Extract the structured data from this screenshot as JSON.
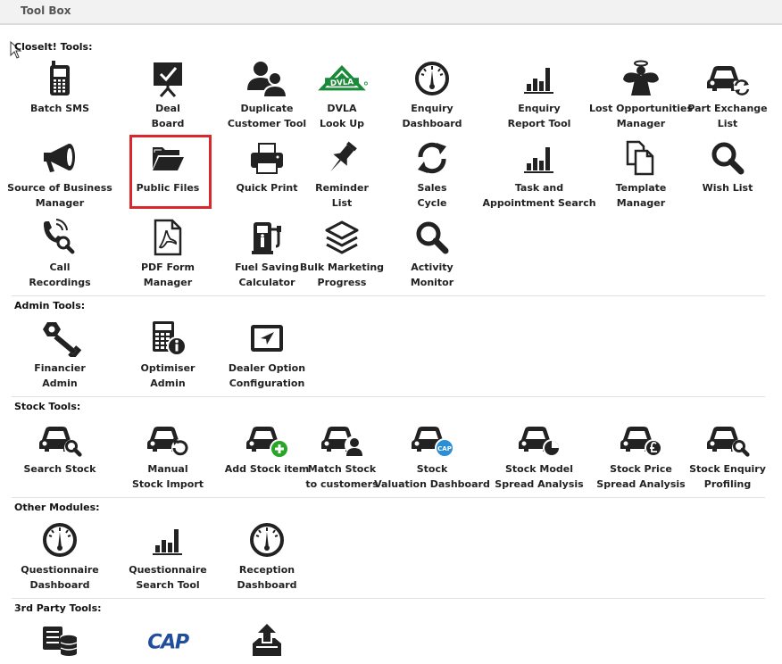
{
  "header": {
    "title": "Tool Box"
  },
  "sections": [
    {
      "title": "CloseIt! Tools:",
      "tools": [
        {
          "label": "Batch SMS",
          "icon": "mobile-phone-icon"
        },
        {
          "label": "Deal\nBoard",
          "icon": "presentation-board-icon"
        },
        {
          "label": "Duplicate\nCustomer Tool",
          "icon": "users-icon"
        },
        {
          "label": "DVLA\nLook Up",
          "icon": "dvla-logo",
          "logo_text": "DVLA"
        },
        {
          "label": "Enquiry\nDashboard",
          "icon": "gauge-icon"
        },
        {
          "label": "Enquiry\nReport Tool",
          "icon": "bar-chart-icon"
        },
        {
          "label": "Lost Opportunities\nManager",
          "icon": "angel-icon"
        },
        {
          "label": "Part Exchange\nList",
          "icon": "car-sync-icon"
        },
        {
          "label": "Source of Business\nManager",
          "icon": "megaphone-icon"
        },
        {
          "label": "Public Files",
          "icon": "folder-open-icon"
        },
        {
          "label": "Quick Print",
          "icon": "printer-icon"
        },
        {
          "label": "Reminder\nList",
          "icon": "pushpin-icon"
        },
        {
          "label": "Sales\nCycle",
          "icon": "refresh-icon"
        },
        {
          "label": "Task and\nAppointment Search",
          "icon": "bar-chart-icon"
        },
        {
          "label": "Template\nManager",
          "icon": "documents-icon"
        },
        {
          "label": "Wish List",
          "icon": "search-icon"
        },
        {
          "label": "Call\nRecordings",
          "icon": "phone-search-icon"
        },
        {
          "label": "PDF Form\nManager",
          "icon": "pdf-file-icon"
        },
        {
          "label": "Fuel Saving\nCalculator",
          "icon": "fuel-pump-icon"
        },
        {
          "label": "Bulk Marketing\nProgress",
          "icon": "layers-icon"
        },
        {
          "label": "Activity\nMonitor",
          "icon": "search-icon"
        }
      ]
    },
    {
      "title": "Admin Tools:",
      "tools": [
        {
          "label": "Financier\nAdmin",
          "icon": "nut-wrench-icon"
        },
        {
          "label": "Optimiser\nAdmin",
          "icon": "calculator-info-icon"
        },
        {
          "label": "Dealer Option\nConfiguration",
          "icon": "screen-navigation-icon"
        }
      ]
    },
    {
      "title": "Stock Tools:",
      "tools": [
        {
          "label": "Search Stock",
          "icon": "car-search-icon"
        },
        {
          "label": "Manual\nStock Import",
          "icon": "car-refresh-icon"
        },
        {
          "label": "Add Stock item",
          "icon": "car-add-icon"
        },
        {
          "label": "Match Stock\nto customers",
          "icon": "car-user-icon"
        },
        {
          "label": "Stock\nValuation Dashboard",
          "icon": "car-cap-icon",
          "badge_text": "CAP"
        },
        {
          "label": "Stock Model\nSpread Analysis",
          "icon": "car-pie-chart-icon"
        },
        {
          "label": "Stock Price\nSpread Analysis",
          "icon": "car-pound-icon"
        },
        {
          "label": "Stock Enquiry\nProfiling",
          "icon": "car-search-icon"
        }
      ]
    },
    {
      "title": "Other Modules:",
      "tools": [
        {
          "label": "Questionnaire\nDashboard",
          "icon": "gauge-icon"
        },
        {
          "label": "Questionnaire\nSearch Tool",
          "icon": "bar-chart-icon"
        },
        {
          "label": "Reception\nDashboard",
          "icon": "gauge-icon"
        }
      ]
    },
    {
      "title": "3rd Party Tools:",
      "tools": [
        {
          "label": "",
          "icon": "database-list-icon"
        },
        {
          "label": "",
          "icon": "cap-logo",
          "logo_text": "CAP"
        },
        {
          "label": "",
          "icon": "tray-upload-icon"
        }
      ]
    }
  ],
  "colors": {
    "icon": "#222222",
    "dvla_green": "#1a8a3a",
    "cap_blue": "#1f4e9c",
    "cap_badge": "#2a8fd6",
    "add_green": "#2aa52a",
    "highlight": "#d9272e"
  },
  "highlighted_tool": "Public Files"
}
